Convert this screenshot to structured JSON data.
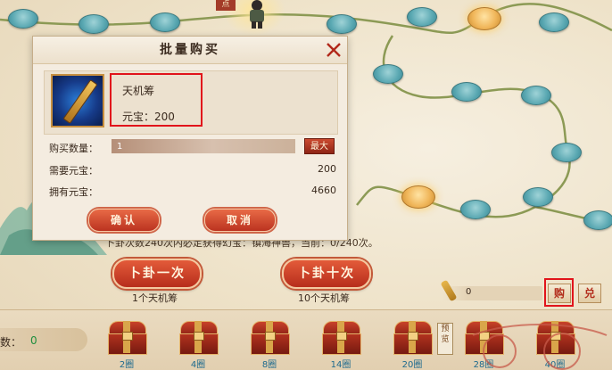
{
  "dialog": {
    "title": "批量购买",
    "item_name": "天机筹",
    "price_label": "元宝：200",
    "qty_label": "购买数量：",
    "qty_value": "1",
    "max_label": "最大",
    "need_label": "需要元宝：",
    "need_value": "200",
    "own_label": "拥有元宝：",
    "own_value": "4660",
    "confirm_label": "确认",
    "cancel_label": "取消"
  },
  "map": {
    "node_label": "点"
  },
  "info_line": "卜卦次数240次内必定获得幻宝：镇海神兽，当前：0/240次。",
  "actions": {
    "once_label": "卜卦一次",
    "once_cost": "1个天机筹",
    "ten_label": "卜卦十次",
    "ten_cost": "10个天机筹",
    "token_count": "0",
    "buy_label": "购",
    "exchange_label": "兑"
  },
  "bottom": {
    "count_label": "数：",
    "count_value": "0",
    "preview_label": "预览",
    "chests": [
      "2圈",
      "4圈",
      "8圈",
      "14圈",
      "20圈",
      "28圈",
      "40圈"
    ]
  },
  "colors": {
    "highlight": "#e1141b",
    "red_button": "#b72d1c",
    "node_teal": "#5aa8b2",
    "node_gold": "#f0b65a"
  }
}
